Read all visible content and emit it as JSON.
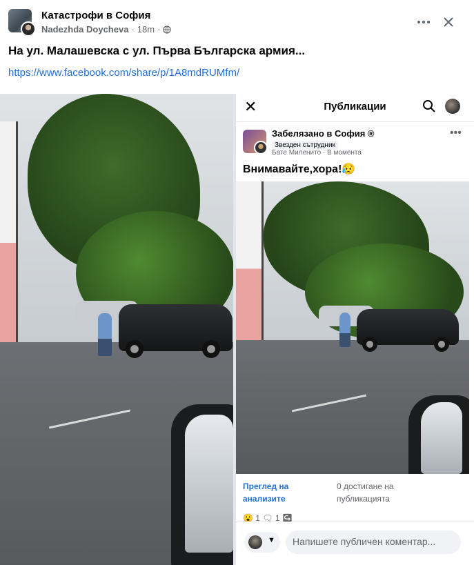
{
  "post": {
    "group_name": "Катастрофи в София",
    "author": "Nadezhda Doycheva",
    "time": "18m",
    "separator": "·",
    "text": "На ул. Малашевска с ул. Първа Българска армия...",
    "link": "https://www.facebook.com/share/p/1A8mdRUMfm/",
    "more_icon": "more-horizontal-icon",
    "close_icon": "close-icon"
  },
  "screenshot": {
    "title": "Публикации",
    "close_glyph": "✕",
    "group_name": "Забелязано в София ®",
    "badge": "Звезден сътрудник",
    "author": "Бате Миленито",
    "time": "В момента",
    "separator": "·",
    "text": "Внимавайте,хора!😥",
    "insights": "Преглед на анализите",
    "reach": "0 достигане на публикацията",
    "reactions": "😮 1   🗨 1   ↪",
    "comment_placeholder": "Напишете публичен коментар..."
  },
  "colors": {
    "link": "#216fdb",
    "muted": "#65676b",
    "text": "#050505"
  }
}
